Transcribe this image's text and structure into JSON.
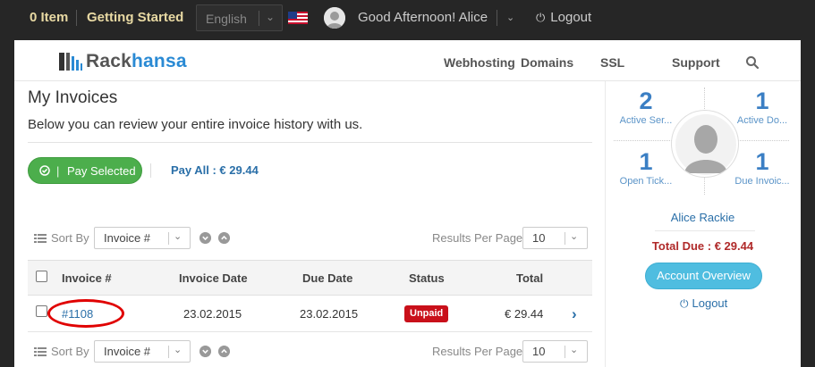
{
  "topbar": {
    "cart_items": "0 Item",
    "getting_started": "Getting Started",
    "language": "English",
    "greeting": "Good Afternoon! Alice",
    "logout": "Logout"
  },
  "header": {
    "logo_part1": "Rack",
    "logo_part2": "hansa",
    "nav": [
      "Webhosting",
      "Domains",
      "SSL",
      "Support"
    ]
  },
  "invoices": {
    "title": "My Invoices",
    "subtitle": "Below you can review your entire invoice history with us.",
    "pay_selected": "Pay Selected",
    "pay_separator": "|",
    "pay_all": "Pay All : € 29.44",
    "sort_by_label": "Sort By",
    "sort_by_value": "Invoice #",
    "results_per_page_label": "Results Per Page",
    "results_per_page_value": "10",
    "columns": [
      "Invoice #",
      "Invoice Date",
      "Due Date",
      "Status",
      "Total"
    ],
    "rows": [
      {
        "invoice": "#1108",
        "invoice_date": "23.02.2015",
        "due_date": "23.02.2015",
        "status": "Unpaid",
        "total": "€ 29.44"
      }
    ]
  },
  "sidebar": {
    "stats": [
      {
        "value": "2",
        "label": "Active Ser..."
      },
      {
        "value": "1",
        "label": "Active Do..."
      },
      {
        "value": "1",
        "label": "Open Tick..."
      },
      {
        "value": "1",
        "label": "Due Invoic..."
      }
    ],
    "user_name": "Alice Rackie",
    "total_due": "Total Due : € 29.44",
    "account_overview": "Account Overview",
    "logout": "Logout"
  },
  "colors": {
    "accent_blue": "#2a6fa8",
    "pay_green": "#4cae4c",
    "unpaid_red": "#c9101a",
    "highlight_oval": "#e00000",
    "account_button": "#4fbde0"
  }
}
